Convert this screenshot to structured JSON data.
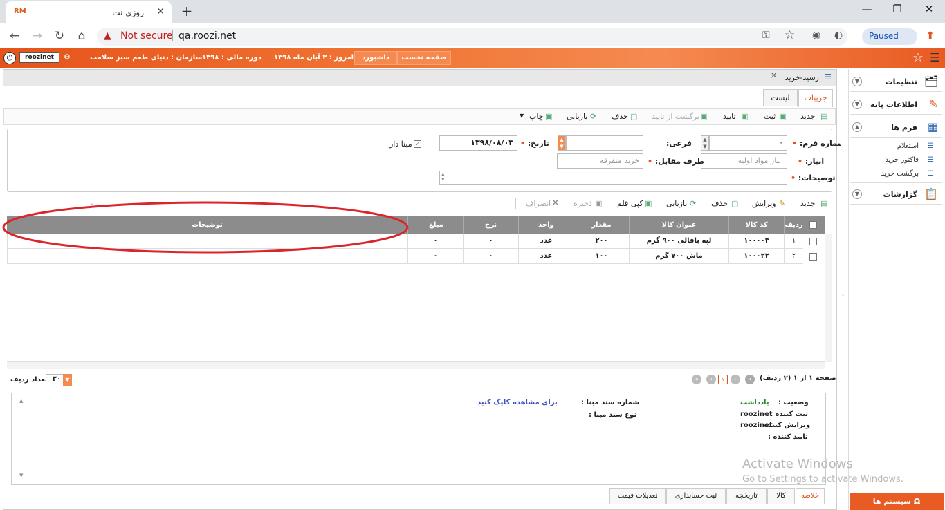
{
  "browser": {
    "tab_title": "روزی نت",
    "favicon_text": "RM",
    "security_label": "Not secure",
    "url": "qa.roozi.net",
    "profile_label": "Paused"
  },
  "header": {
    "username": "roozinet",
    "org_label": "سازمان :",
    "org_value": "دنیای طعم سبز سلامت",
    "fiscal_label": "دوره مالی :",
    "fiscal_value": "۱۳۹۸",
    "today_label": "امروز :",
    "today_value": "۳ آبان ماه ۱۳۹۸",
    "dashboard_btn": "داشبورد",
    "home_btn": "صفحه نخست"
  },
  "document": {
    "title": "رسید-خرید",
    "tabs": [
      "جزییات",
      "لیست"
    ]
  },
  "toolbar": {
    "new": "جدید",
    "save": "ثبت",
    "confirm": "تایید",
    "unconfirm": "برگشت از تایید",
    "delete": "حذف",
    "refresh": "بازیابی",
    "print": "چاپ"
  },
  "form": {
    "form_no_label": "شماره فرم:",
    "form_no_value": "۰",
    "sub_label": "فرعی:",
    "date_label": "تاریخ:",
    "date_value": "۱۳۹۸/۰۸/۰۳",
    "based_label": "مبنا دار",
    "warehouse_label": "انبار:",
    "warehouse_placeholder": "انبار مواد اولیه",
    "party_label": "طرف مقابل:",
    "party_placeholder": "خرید متفرقه",
    "desc_label": "توضیحات:"
  },
  "grid_toolbar": {
    "new": "جدید",
    "edit": "ویرایش",
    "delete": "حذف",
    "refresh": "بازیابی",
    "copy": "کپی قلم",
    "save": "ذخیره",
    "cancel": "انصراف"
  },
  "grid": {
    "columns": [
      "ردیف",
      "کد کالا",
      "عنوان کالا",
      "مقدار",
      "واحد",
      "نرخ",
      "مبلغ",
      "توضیحات"
    ],
    "rows": [
      [
        "۱",
        "۱۰۰۰۰۳",
        "لپه باقالی ۹۰۰ گرم",
        "۲۰۰",
        "عدد",
        "۰",
        "۰",
        ""
      ],
      [
        "۲",
        "۱۰۰۰۲۲",
        "ماش ۷۰۰ گرم",
        "۱۰۰",
        "عدد",
        "۰",
        "۰",
        ""
      ]
    ]
  },
  "pager": {
    "page_text": "صفحه ۱ از ۱ (۲ ردیف)",
    "current_page": "۱",
    "rows_label": "تعداد ردیف",
    "rows_value": "۳۰"
  },
  "info": {
    "status_label": "وضعیت :",
    "status_value": "یادداشت",
    "creator_label": "ثبت کننده :",
    "creator_value": "roozinet",
    "editor_label": "ویرایش کننده :",
    "editor_value": "roozinet",
    "approver_label": "تایید کننده :",
    "base_doc_no_label": "شماره سند مبنا :",
    "base_doc_type_label": "نوع سند مبنا :",
    "view_link": "برای مشاهده کلیک کنید"
  },
  "bottom_tabs": [
    "خلاصه",
    "کالا",
    "تاریخچه",
    "ثبت حسابداری",
    "تعدیلات قیمت"
  ],
  "sidebar": {
    "settings": "تنظیمات",
    "base_info": "اطلاعات پایه",
    "forms": "فرم ها",
    "sub_items": [
      "استعلام",
      "فاکتور خرید",
      "برگشت خرید"
    ],
    "reports": "گزارشات",
    "systems": "سیستم ها"
  },
  "watermark": {
    "line1": "Activate Windows",
    "line2": "Go to Settings to activate Windows."
  },
  "colors": {
    "accent": "#e85b22",
    "grid_header": "#8c8c8c",
    "annotation": "#d9262a"
  }
}
